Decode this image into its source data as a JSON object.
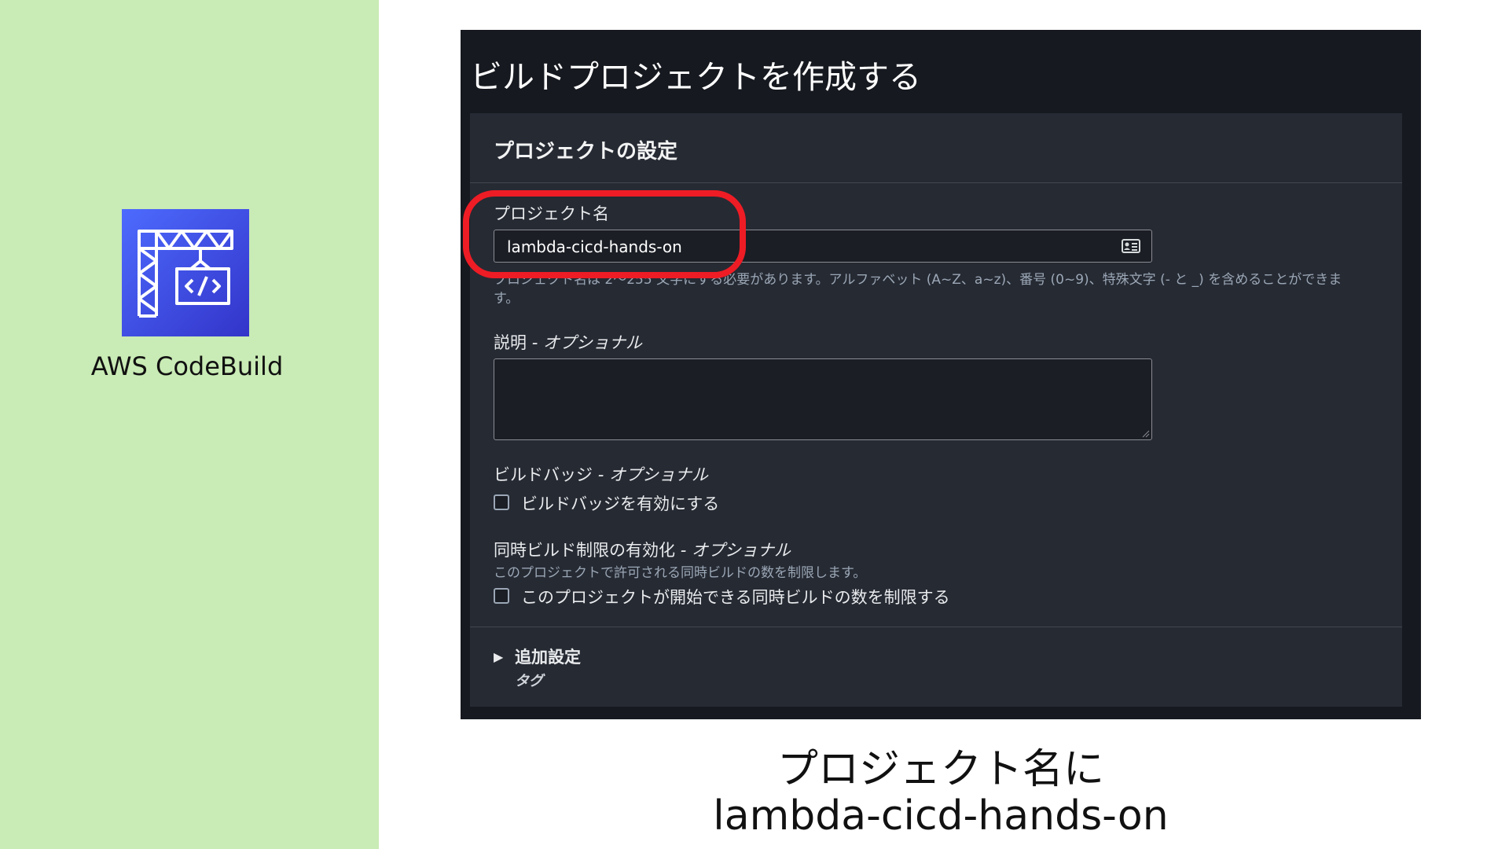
{
  "left_panel": {
    "icon": "codebuild-crane-icon",
    "service_name": "AWS CodeBuild"
  },
  "console": {
    "page_title": "ビルドプロジェクトを作成する",
    "section_title": "プロジェクトの設定",
    "project_name": {
      "label": "プロジェクト名",
      "value": "lambda-cicd-hands-on",
      "icon": "contact-card-icon",
      "hint": "プロジェクト名は 2～255 文字にする必要があります。アルファベット (A~Z、a~z)、番号 (0~9)、特殊文字 (- と _) を含めることができます。"
    },
    "description": {
      "label": "説明",
      "optional": "- オプショナル",
      "value": ""
    },
    "build_badge": {
      "label": "ビルドバッジ",
      "optional": "- オプショナル",
      "checkbox_label": "ビルドバッジを有効にする",
      "checked": false
    },
    "concurrent_limit": {
      "label": "同時ビルド制限の有効化",
      "optional": "- オプショナル",
      "description": "このプロジェクトで許可される同時ビルドの数を制限します。",
      "checkbox_label": "このプロジェクトが開始できる同時ビルドの数を制限する",
      "checked": false
    },
    "additional": {
      "caret": "▶",
      "label": "追加設定",
      "sub": "タグ"
    }
  },
  "highlight_color": "#ee1c25",
  "caption": {
    "line1": "プロジェクト名に",
    "line2": "lambda-cicd-hands-on"
  }
}
